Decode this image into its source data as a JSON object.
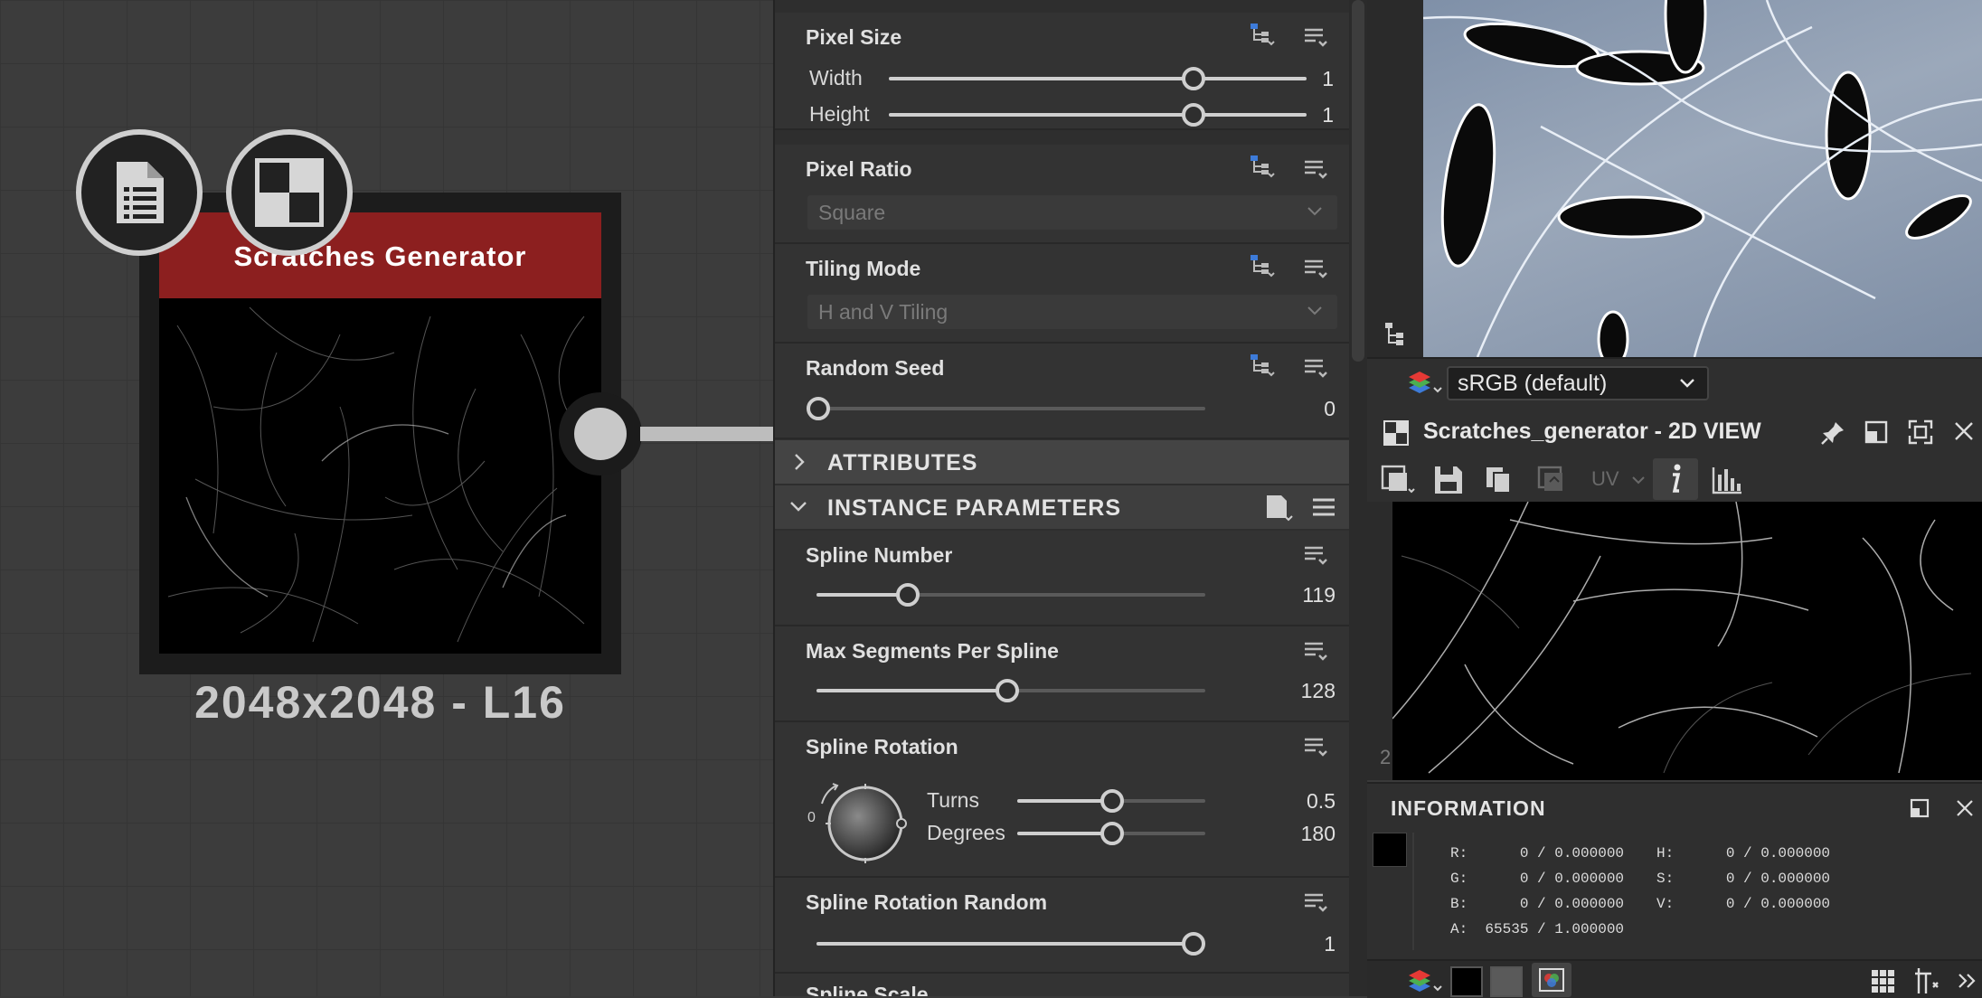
{
  "graph": {
    "node_title": "Scratches Generator",
    "node_resolution": "2048x2048 - L16"
  },
  "properties": {
    "pixel_size": {
      "title": "Pixel Size",
      "width_label": "Width",
      "width_value": "1",
      "height_label": "Height",
      "height_value": "1"
    },
    "pixel_ratio": {
      "title": "Pixel Ratio",
      "value": "Square"
    },
    "tiling_mode": {
      "title": "Tiling Mode",
      "value": "H and V Tiling"
    },
    "random_seed": {
      "title": "Random Seed",
      "value": "0"
    },
    "attributes_label": "ATTRIBUTES",
    "instance_parameters_label": "INSTANCE PARAMETERS",
    "spline_number": {
      "title": "Spline Number",
      "value": "119"
    },
    "max_segments": {
      "title": "Max Segments Per Spline",
      "value": "128"
    },
    "spline_rotation": {
      "title": "Spline Rotation",
      "dial_zero": "0",
      "turns_label": "Turns",
      "turns_value": "0.5",
      "degrees_label": "Degrees",
      "degrees_value": "180"
    },
    "spline_rotation_random": {
      "title": "Spline Rotation Random",
      "value": "1"
    },
    "next_partial": "Spline Scale"
  },
  "viewer": {
    "colorspace": "sRGB (default)",
    "view2d_title": "Scratches_generator - 2D VIEW",
    "uv_label": "UV",
    "corner_number": "2"
  },
  "information": {
    "title": "INFORMATION",
    "r": "R:      0 / 0.000000",
    "g": "G:      0 / 0.000000",
    "b": "B:      0 / 0.000000",
    "a": "A:  65535 / 1.000000",
    "h": "H:      0 / 0.000000",
    "s": "S:      0 / 0.000000",
    "v": "V:      0 / 0.000000"
  },
  "colors": {
    "node_header": "#8c1f1f",
    "accent_blue": "#3d7bd9"
  }
}
